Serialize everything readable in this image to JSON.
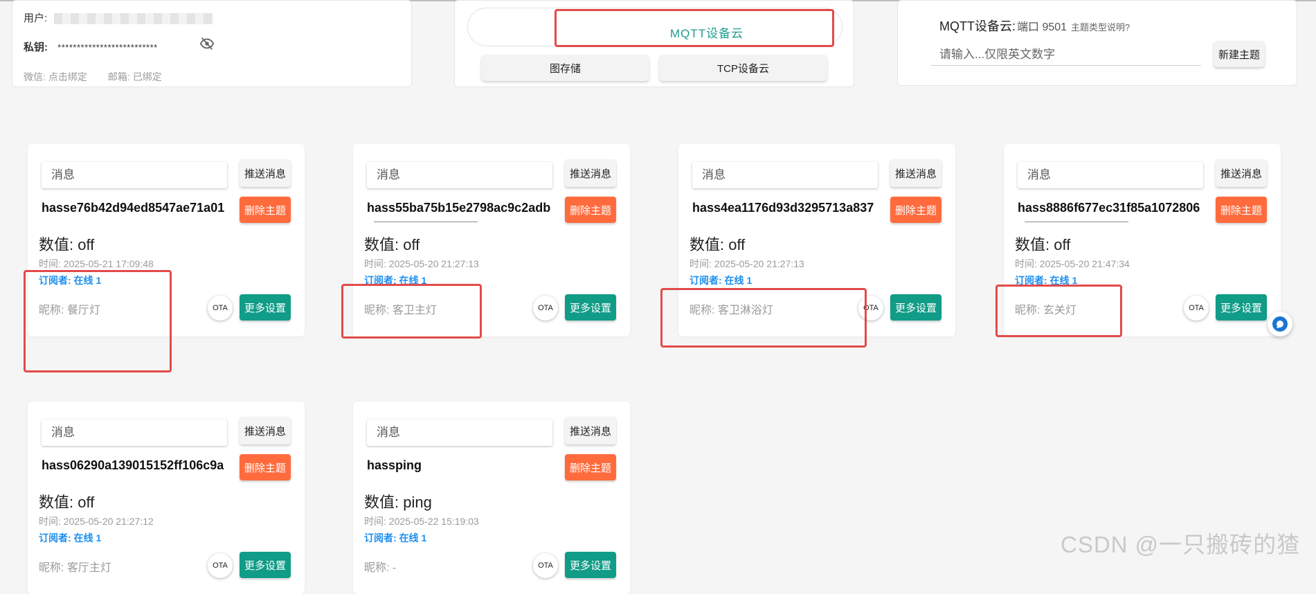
{
  "account": {
    "user_label": "用户:",
    "key_label": "私钥:",
    "key_masked": "**************************",
    "wechat_label": "微信:",
    "wechat_value": "点击绑定",
    "email_label": "邮箱:",
    "email_value": "已绑定"
  },
  "cloud": {
    "active": "MQTT设备云",
    "tabs": [
      "图存储",
      "TCP设备云"
    ]
  },
  "new_topic": {
    "title": "MQTT设备云:",
    "port": "端口 9501",
    "help": "主题类型说明?",
    "placeholder": "请输入...仅限英文数字",
    "button": "新建主题"
  },
  "card_labels": {
    "msg_placeholder": "消息",
    "send": "推送消息",
    "delete": "删除主题",
    "ota": "OTA",
    "more": "更多设置"
  },
  "cards": [
    {
      "topic": "hasse76b42d94ed8547ae71a01",
      "value": "数值: off",
      "time": "时间: 2025-05-21 17:09:48",
      "subs": "订阅者: 在线 1",
      "nick": "昵称: 餐厅灯"
    },
    {
      "topic": "hass55ba75b15e2798ac9c2adb",
      "value": "数值: off",
      "time": "时间: 2025-05-20 21:27:13",
      "subs": "订阅者: 在线 1",
      "nick": "昵称: 客卫主灯"
    },
    {
      "topic": "hass4ea1176d93d3295713a837",
      "value": "数值: off",
      "time": "时间: 2025-05-20 21:27:13",
      "subs": "订阅者: 在线 1",
      "nick": "昵称: 客卫淋浴灯"
    },
    {
      "topic": "hass8886f677ec31f85a1072806",
      "value": "数值: off",
      "time": "时间: 2025-05-20 21:47:34",
      "subs": "订阅者: 在线 1",
      "nick": "昵称: 玄关灯"
    },
    {
      "topic": "hass06290a139015152ff106c9a",
      "value": "数值: off",
      "time": "时间: 2025-05-20 21:27:12",
      "subs": "订阅者: 在线 1",
      "nick": "昵称: 客厅主灯"
    },
    {
      "topic": "hassping",
      "value": "数值: ping",
      "time": "时间: 2025-05-22 15:19:03",
      "subs": "订阅者: 在线 1",
      "nick": "昵称: -"
    }
  ],
  "watermark": "CSDN @一只搬砖的猹",
  "colors": {
    "accent": "#119c87",
    "danger": "#ff6b3d",
    "link": "#1b8ef0",
    "highlight": "#e34a4a"
  }
}
